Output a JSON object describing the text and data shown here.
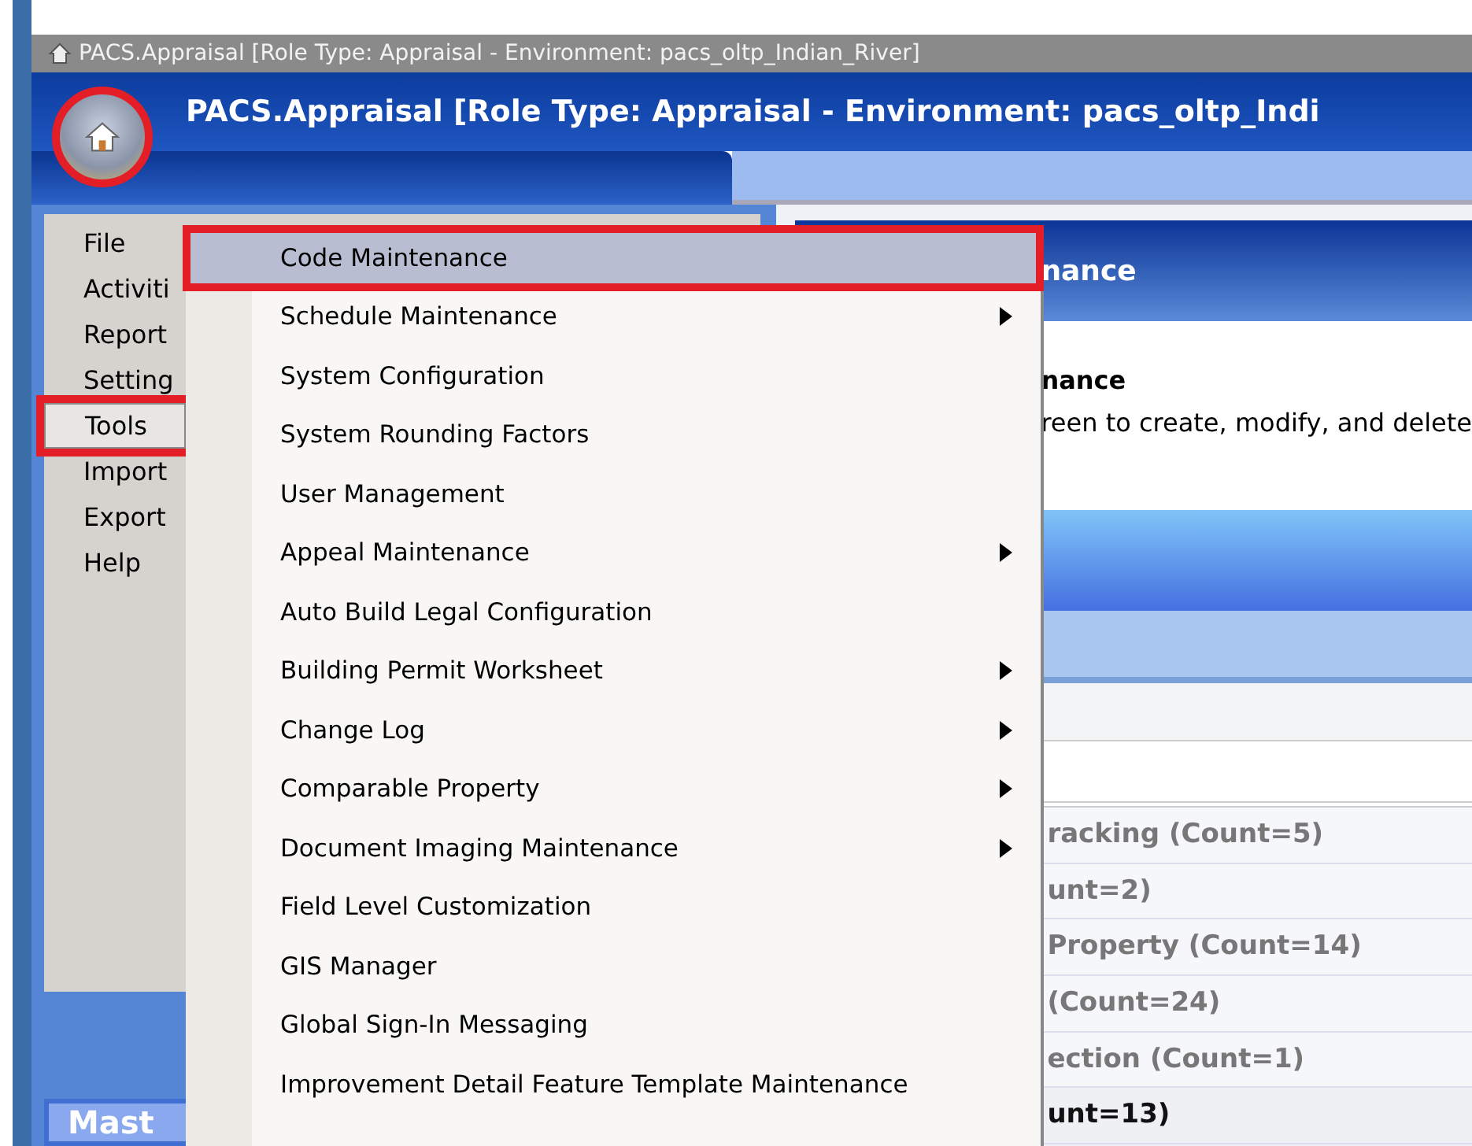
{
  "outer_window": {
    "title": "PACS.Appraisal [Role Type: Appraisal - Environment: pacs_oltp_Indian_River]"
  },
  "app": {
    "title": "PACS.Appraisal [Role Type: Appraisal - Environment: pacs_oltp_Indi",
    "orb_highlighted": true
  },
  "app_menu": {
    "items": [
      {
        "label": "File",
        "selected": false,
        "highlighted": false
      },
      {
        "label": "Activiti",
        "selected": false,
        "highlighted": false
      },
      {
        "label": "Report",
        "selected": false,
        "highlighted": false
      },
      {
        "label": "Setting",
        "selected": false,
        "highlighted": false
      },
      {
        "label": "Tools",
        "selected": true,
        "highlighted": true
      },
      {
        "label": "Import",
        "selected": false,
        "highlighted": false
      },
      {
        "label": "Export",
        "selected": false,
        "highlighted": false
      },
      {
        "label": "Help",
        "selected": false,
        "highlighted": false
      }
    ]
  },
  "submenu": {
    "items": [
      {
        "label": "Code Maintenance",
        "selected": true,
        "highlighted": true,
        "has_submenu": false
      },
      {
        "label": "Schedule Maintenance",
        "selected": false,
        "highlighted": false,
        "has_submenu": true
      },
      {
        "label": "System Configuration",
        "selected": false,
        "highlighted": false,
        "has_submenu": false
      },
      {
        "label": "System Rounding Factors",
        "selected": false,
        "highlighted": false,
        "has_submenu": false
      },
      {
        "label": "User Management",
        "selected": false,
        "highlighted": false,
        "has_submenu": false
      },
      {
        "label": "Appeal Maintenance",
        "selected": false,
        "highlighted": false,
        "has_submenu": true
      },
      {
        "label": "Auto Build Legal Configuration",
        "selected": false,
        "highlighted": false,
        "has_submenu": false
      },
      {
        "label": "Building Permit Worksheet",
        "selected": false,
        "highlighted": false,
        "has_submenu": true
      },
      {
        "label": "Change Log",
        "selected": false,
        "highlighted": false,
        "has_submenu": true
      },
      {
        "label": "Comparable Property",
        "selected": false,
        "highlighted": false,
        "has_submenu": true
      },
      {
        "label": "Document Imaging Maintenance",
        "selected": false,
        "highlighted": false,
        "has_submenu": true
      },
      {
        "label": "Field Level Customization",
        "selected": false,
        "highlighted": false,
        "has_submenu": false
      },
      {
        "label": "GIS Manager",
        "selected": false,
        "highlighted": false,
        "has_submenu": false
      },
      {
        "label": "Global Sign-In Messaging",
        "selected": false,
        "highlighted": false,
        "has_submenu": false
      },
      {
        "label": "Improvement Detail Feature Template Maintenance",
        "selected": false,
        "highlighted": false,
        "has_submenu": false
      }
    ]
  },
  "content": {
    "header": "nance",
    "heading": "nance",
    "description": "reen to create, modify, and delete",
    "rows": [
      {
        "text": "racking (Count=5)",
        "selected": false
      },
      {
        "text": "unt=2)",
        "selected": false
      },
      {
        "text": "Property (Count=14)",
        "selected": false
      },
      {
        "text": "(Count=24)",
        "selected": false
      },
      {
        "text": "ection (Count=1)",
        "selected": false
      },
      {
        "text": "unt=13)",
        "selected": true
      }
    ]
  },
  "bottom_tabs": [
    {
      "label": "Mast"
    }
  ]
}
